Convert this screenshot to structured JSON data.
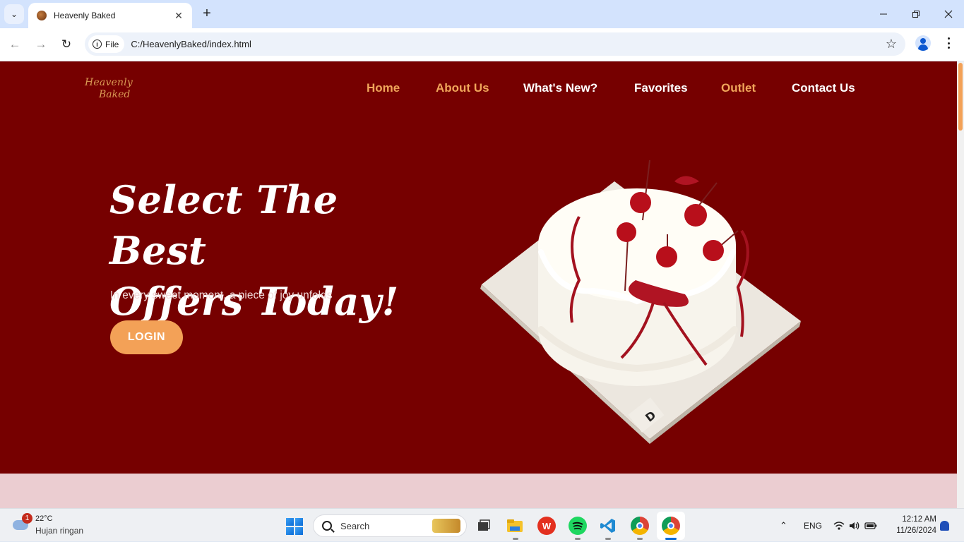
{
  "browser": {
    "tab_title": "Heavenly Baked",
    "chip_label": "File",
    "url": "C:/HeavenlyBaked/index.html"
  },
  "site": {
    "logo_line1": "Heavenly",
    "logo_line2": "Baked",
    "nav": [
      {
        "label": "Home",
        "color": "#f0a55a"
      },
      {
        "label": "About Us",
        "color": "#f0a55a"
      },
      {
        "label": "What's New?",
        "color": "#ffffff"
      },
      {
        "label": "Favorites",
        "color": "#ffffff"
      },
      {
        "label": "Outlet",
        "color": "#f0a55a"
      },
      {
        "label": "Contact Us",
        "color": "#ffffff"
      }
    ],
    "headline_line1": "Select The Best",
    "headline_line2": "Offers Today!",
    "subtitle": "In every sweet moment, a piece of joy unfolds",
    "login_label": "LOGIN",
    "colors": {
      "hero_bg": "#760000",
      "accent": "#f3a157",
      "section_bg": "#ebcdd1"
    }
  },
  "taskbar": {
    "weather_badge": "1",
    "temperature": "22°C",
    "condition": "Hujan ringan",
    "search_placeholder": "Search",
    "language": "ENG",
    "time": "12:12 AM",
    "date": "11/26/2024",
    "apps": [
      "task-view-icon",
      "file-explorer-icon",
      "wps-office-icon",
      "spotify-icon",
      "vscode-icon",
      "chrome-profile-icon",
      "chrome-icon"
    ]
  }
}
